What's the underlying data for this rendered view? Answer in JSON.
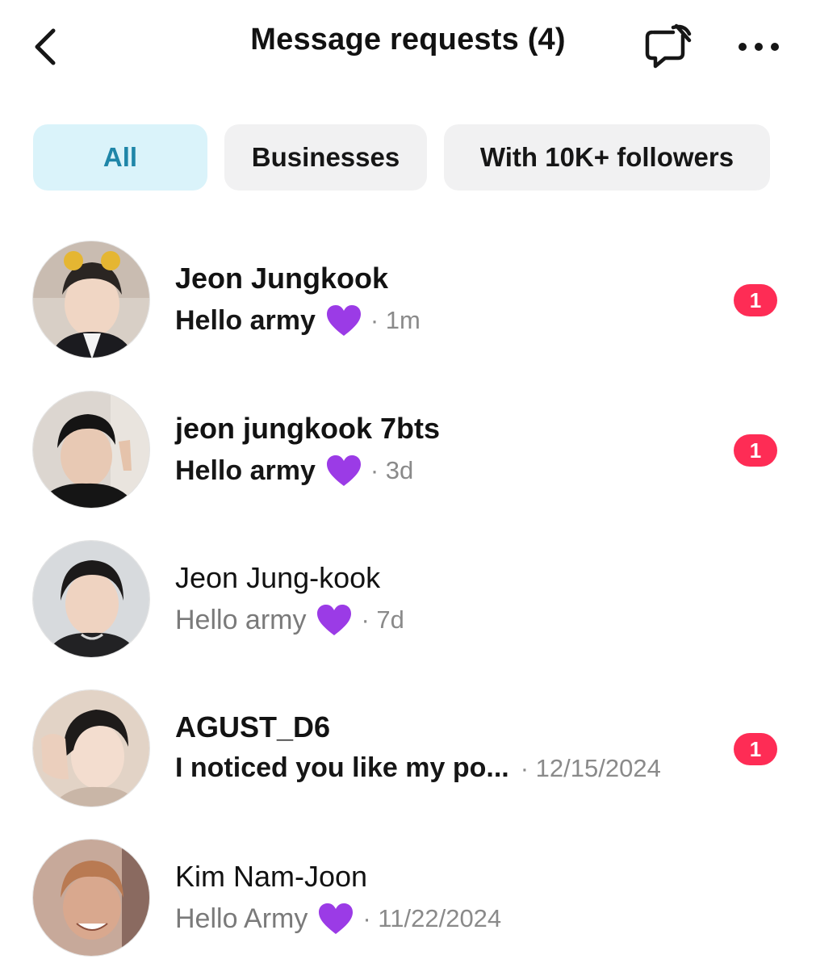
{
  "header": {
    "title": "Message requests (4)",
    "back_icon": "chevron-left-icon",
    "mute_icon": "chat-bubble-muted-icon",
    "more_icon": "more-horizontal-icon"
  },
  "filters": [
    {
      "label": "All",
      "active": true
    },
    {
      "label": "Businesses",
      "active": false
    },
    {
      "label": "With 10K+ followers",
      "active": false
    }
  ],
  "requests": [
    {
      "name": "Jeon Jungkook",
      "message": "Hello army",
      "emoji": "purple-heart",
      "time": "· 1m",
      "unread_count": "1",
      "unread": true
    },
    {
      "name": "jeon jungkook 7bts",
      "message": "Hello army",
      "emoji": "purple-heart",
      "time": "· 3d",
      "unread_count": "1",
      "unread": true
    },
    {
      "name": "Jeon Jung-kook",
      "message": "Hello army",
      "emoji": "purple-heart",
      "time": "· 7d",
      "unread_count": "",
      "unread": false
    },
    {
      "name": "AGUST_D6",
      "message": "I noticed you like my po...",
      "emoji": "",
      "time": "· 12/15/2024",
      "unread_count": "1",
      "unread": true
    },
    {
      "name": "Kim Nam-Joon",
      "message": "Hello Army",
      "emoji": "purple-heart",
      "time": "· 11/22/2024",
      "unread_count": "",
      "unread": false
    }
  ],
  "colors": {
    "accent_chip_bg": "#daf3fa",
    "accent_chip_text": "#1f86a8",
    "badge": "#fe2c55",
    "heart": "#9b3be6"
  }
}
